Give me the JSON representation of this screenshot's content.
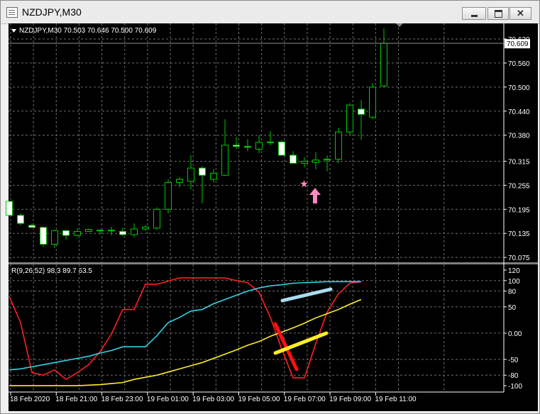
{
  "window": {
    "title": "NZDJPY,M30"
  },
  "chart_data": [
    {
      "type": "candlestick",
      "title": "NZDJPY,M30  70.503 70.646 70.500 70.609",
      "y_ticks": [
        "70.620",
        "70.560",
        "70.500",
        "70.440",
        "70.380",
        "70.315",
        "70.255",
        "70.195",
        "70.135",
        "70.075"
      ],
      "y_range": [
        70.07,
        70.65
      ],
      "current_price": "70.609",
      "x_labels": [
        "18 Feb 2020",
        "18 Feb 21:00",
        "18 Feb 23:00",
        "19 Feb 01:00",
        "19 Feb 03:00",
        "19 Feb 05:00",
        "19 Feb 07:00",
        "19 Feb 09:00",
        "19 Feb 11:00"
      ],
      "candles": [
        [
          70.215,
          70.21,
          70.185,
          70.18
        ],
        [
          70.18,
          70.185,
          70.155,
          70.16
        ],
        [
          70.155,
          70.16,
          70.15,
          70.15
        ],
        [
          70.15,
          70.152,
          70.102,
          70.108
        ],
        [
          70.108,
          70.144,
          70.098,
          70.142
        ],
        [
          70.142,
          70.142,
          70.12,
          70.13
        ],
        [
          70.13,
          70.148,
          70.128,
          70.14
        ],
        [
          70.14,
          70.147,
          70.138,
          70.145
        ],
        [
          70.143,
          70.146,
          70.132,
          70.142
        ],
        [
          70.142,
          70.152,
          70.13,
          70.143
        ],
        [
          70.14,
          70.15,
          70.128,
          70.132
        ],
        [
          70.132,
          70.16,
          70.125,
          70.146
        ],
        [
          70.146,
          70.156,
          70.141,
          70.151
        ],
        [
          70.148,
          70.2,
          70.145,
          70.195
        ],
        [
          70.195,
          70.27,
          70.185,
          70.262
        ],
        [
          70.262,
          70.275,
          70.25,
          70.27
        ],
        [
          70.265,
          70.33,
          70.245,
          70.298
        ],
        [
          70.298,
          70.302,
          70.21,
          70.28
        ],
        [
          70.27,
          70.295,
          70.262,
          70.285
        ],
        [
          70.28,
          70.42,
          70.278,
          70.355
        ],
        [
          70.355,
          70.375,
          70.345,
          70.352
        ],
        [
          70.352,
          70.37,
          70.34,
          70.35
        ],
        [
          70.345,
          70.38,
          70.335,
          70.362
        ],
        [
          70.362,
          70.39,
          70.355,
          70.363
        ],
        [
          70.363,
          70.368,
          70.345,
          70.33
        ],
        [
          70.33,
          70.34,
          70.318,
          70.31
        ],
        [
          70.31,
          70.325,
          70.3,
          70.315
        ],
        [
          70.312,
          70.338,
          70.295,
          70.318
        ],
        [
          70.318,
          70.33,
          70.29,
          70.32
        ],
        [
          70.32,
          70.398,
          70.31,
          70.388
        ],
        [
          70.388,
          70.46,
          70.38,
          70.455
        ],
        [
          70.445,
          70.468,
          70.368,
          70.432
        ],
        [
          70.425,
          70.51,
          70.42,
          70.5
        ],
        [
          70.503,
          70.646,
          70.5,
          70.609
        ]
      ]
    },
    {
      "type": "line",
      "title": "R(9,26,52) 98.3 89.7 63.5",
      "y_ticks": [
        "120",
        "100",
        "80",
        "50",
        "0.00",
        "-50",
        "-80",
        "-100"
      ],
      "y_range": [
        -108,
        124
      ],
      "series": [
        {
          "color": "#ff2020",
          "values": [
            70,
            20,
            -75,
            -80,
            -70,
            -88,
            -75,
            -60,
            -35,
            -2,
            45,
            45,
            93,
            93,
            99,
            105,
            105,
            105,
            105,
            105,
            100,
            96,
            78,
            30,
            -30,
            -85,
            -85,
            -20,
            40,
            75,
            95,
            98
          ]
        },
        {
          "color": "#33d4e8",
          "values": [
            -70,
            -68,
            -64,
            -60,
            -56,
            -52,
            -48,
            -44,
            -38,
            -33,
            -26,
            -26,
            -26,
            -5,
            20,
            30,
            42,
            45,
            56,
            64,
            72,
            80,
            86,
            90,
            92,
            95,
            96,
            97,
            98,
            98,
            98,
            98
          ]
        },
        {
          "color": "#ffee22",
          "values": [
            -100,
            -100,
            -100,
            -100,
            -100,
            -100,
            -100,
            -99,
            -98,
            -96,
            -94,
            -88,
            -84,
            -80,
            -74,
            -68,
            -62,
            -56,
            -48,
            -40,
            -32,
            -23,
            -16,
            -6,
            2,
            10,
            19,
            29,
            37,
            45,
            55,
            64
          ]
        }
      ]
    }
  ]
}
